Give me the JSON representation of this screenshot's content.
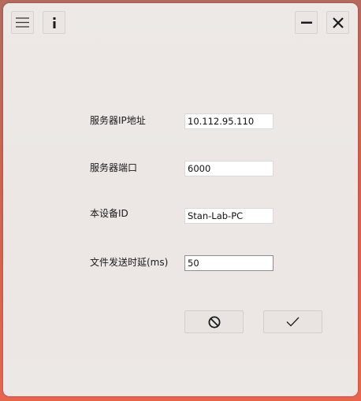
{
  "titlebar": {
    "menu_icon": "hamburger-menu-icon",
    "info_icon": "info-icon",
    "minimize_icon": "minimize-icon",
    "close_icon": "close-icon"
  },
  "form": {
    "fields": [
      {
        "label": "服务器IP地址",
        "value": "10.112.95.110"
      },
      {
        "label": "服务器端口",
        "value": "6000"
      },
      {
        "label": "本设备ID",
        "value": "Stan-Lab-PC"
      },
      {
        "label": "文件发送时延(ms)",
        "value": "50"
      }
    ]
  },
  "actions": {
    "cancel_icon": "cancel-icon",
    "confirm_icon": "checkmark-icon"
  },
  "colors": {
    "window_background": "#ece8e6",
    "desktop_accent": "#e9644f",
    "input_border": "#d9d9d9",
    "focused_input_border": "#8f8f8f"
  }
}
